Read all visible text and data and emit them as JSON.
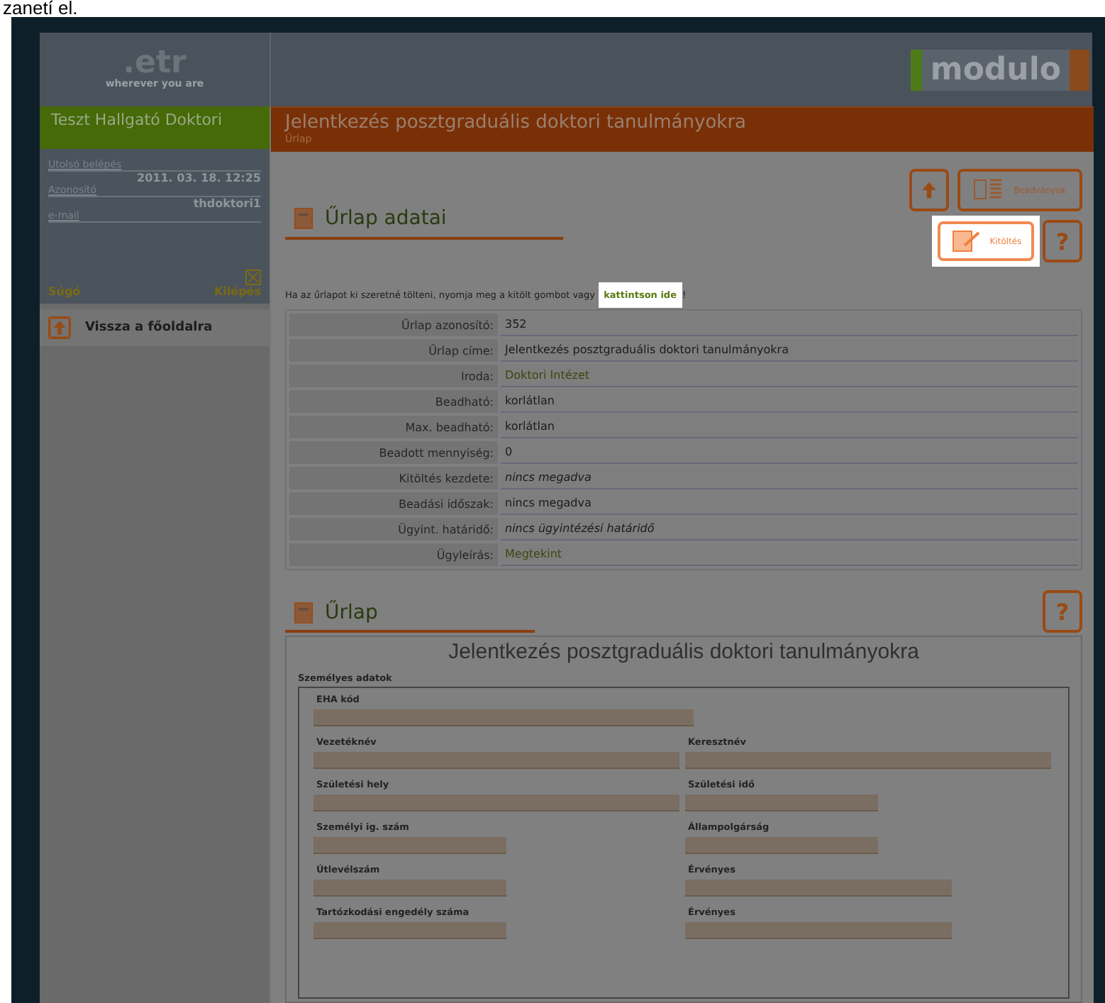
{
  "caption": "zanetí el.",
  "header": {
    "logo": ".etr",
    "tagline": "wherever you are",
    "brand": "modulo"
  },
  "user": {
    "name": "Teszt Hallgató Doktori",
    "info": [
      {
        "label": "Utolsó belépés",
        "value": "2011. 03. 18. 12:25"
      },
      {
        "label": "Azonosító",
        "value": "thdoktori1"
      },
      {
        "label": "e-mail"
      }
    ],
    "help": "Súgó",
    "logout": "Kilépés"
  },
  "sidebar": {
    "items": [
      {
        "label": "Vissza a főoldalra"
      }
    ]
  },
  "page": {
    "title": "Jelentkezés posztgraduális doktori tanulmányokra",
    "subtitle": "Űrlap"
  },
  "toolbar": {
    "submissions": "Beadványok",
    "fill": "Kitöltés",
    "fill_highlighted": true,
    "help": "?"
  },
  "details": {
    "heading": "Űrlap adatai",
    "instruction_before": "Ha az űrlapot ki szeretné tölteni, nyomja meg a kitölt gombot vagy ",
    "instruction_link": "kattintson ide",
    "instruction_after": "!",
    "link_highlighted": true,
    "rows": [
      {
        "label": "Űrlap azonosító:",
        "value": "352",
        "kind": "text"
      },
      {
        "label": "Űrlap címe:",
        "value": "Jelentkezés posztgraduális doktori tanulmányokra",
        "kind": "text"
      },
      {
        "label": "Iroda:",
        "value": "Doktori Intézet",
        "kind": "link"
      },
      {
        "label": "Beadható:",
        "value": "korlátlan",
        "kind": "text"
      },
      {
        "label": "Max. beadható:",
        "value": "korlátlan",
        "kind": "text"
      },
      {
        "label": "Beadott mennyiség:",
        "value": "0",
        "kind": "text"
      },
      {
        "label": "Kitöltés kezdete:",
        "value": "nincs megadva",
        "kind": "italic"
      },
      {
        "label": "Beadási időszak:",
        "value": "nincs megadva",
        "kind": "text"
      },
      {
        "label": "Ügyint. határidő:",
        "value": "nincs ügyintézési határidő",
        "kind": "italic"
      },
      {
        "label": "Ügyleírás:",
        "value": "Megtekint",
        "kind": "link"
      }
    ]
  },
  "form": {
    "heading": "Űrlap",
    "help": "?",
    "title": "Jelentkezés posztgraduális doktori tanulmányokra",
    "section": "Személyes adatok",
    "rows": [
      [
        {
          "label": "EHA kód"
        }
      ],
      [
        {
          "label": "Vezetéknév"
        },
        {
          "label": "Keresztnév"
        }
      ],
      [
        {
          "label": "Születési hely"
        },
        {
          "label": "Születési idő"
        }
      ],
      [
        {
          "label": "Személyi ig. szám"
        },
        {
          "label": "Állampolgárság"
        }
      ],
      [
        {
          "label": "Útlevélszám"
        },
        {
          "label": "Érvényes"
        }
      ],
      [
        {
          "label": "Tartózkodási engedély száma"
        },
        {
          "label": "Érvényes"
        }
      ]
    ]
  }
}
